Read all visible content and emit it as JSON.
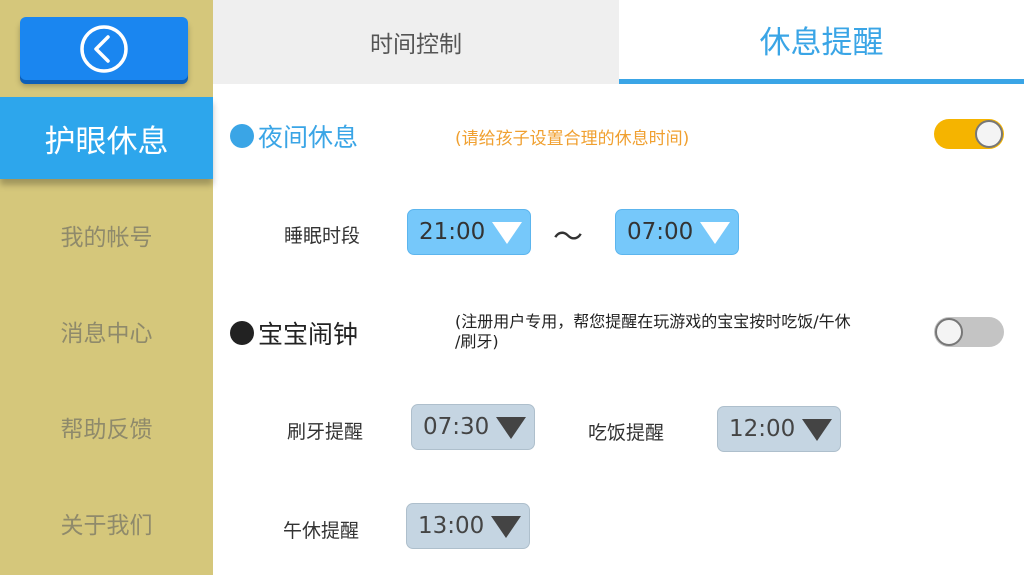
{
  "sidebar": {
    "back_icon": "chevron-left-circle-icon",
    "items": [
      {
        "label": "护眼休息",
        "active": true
      },
      {
        "label": "我的帐号"
      },
      {
        "label": "消息中心"
      },
      {
        "label": "帮助反馈"
      },
      {
        "label": "关于我们"
      }
    ]
  },
  "tabs": [
    {
      "label": "时间控制",
      "active": false
    },
    {
      "label": "休息提醒",
      "active": true
    }
  ],
  "night_rest": {
    "title": "夜间休息",
    "note": "(请给孩子设置合理的休息时间)",
    "enabled": true,
    "sleep_label": "睡眠时段",
    "start": "21:00",
    "separator": "～",
    "end": "07:00"
  },
  "baby_alarm": {
    "title": "宝宝闹钟",
    "note_line1": "(注册用户专用，帮您提醒在玩游戏的宝宝按时吃饭/午休",
    "note_line2": "/刷牙)",
    "enabled": false,
    "brush_label": "刷牙提醒",
    "brush_time": "07:30",
    "meal_label": "吃饭提醒",
    "meal_time": "12:00",
    "nap_label": "午休提醒",
    "nap_time": "13:00"
  },
  "colors": {
    "accent_blue": "#3aa5e6",
    "toggle_on": "#f5b400",
    "note_orange": "#f0a030",
    "sidebar_bg": "#d5c77b"
  }
}
